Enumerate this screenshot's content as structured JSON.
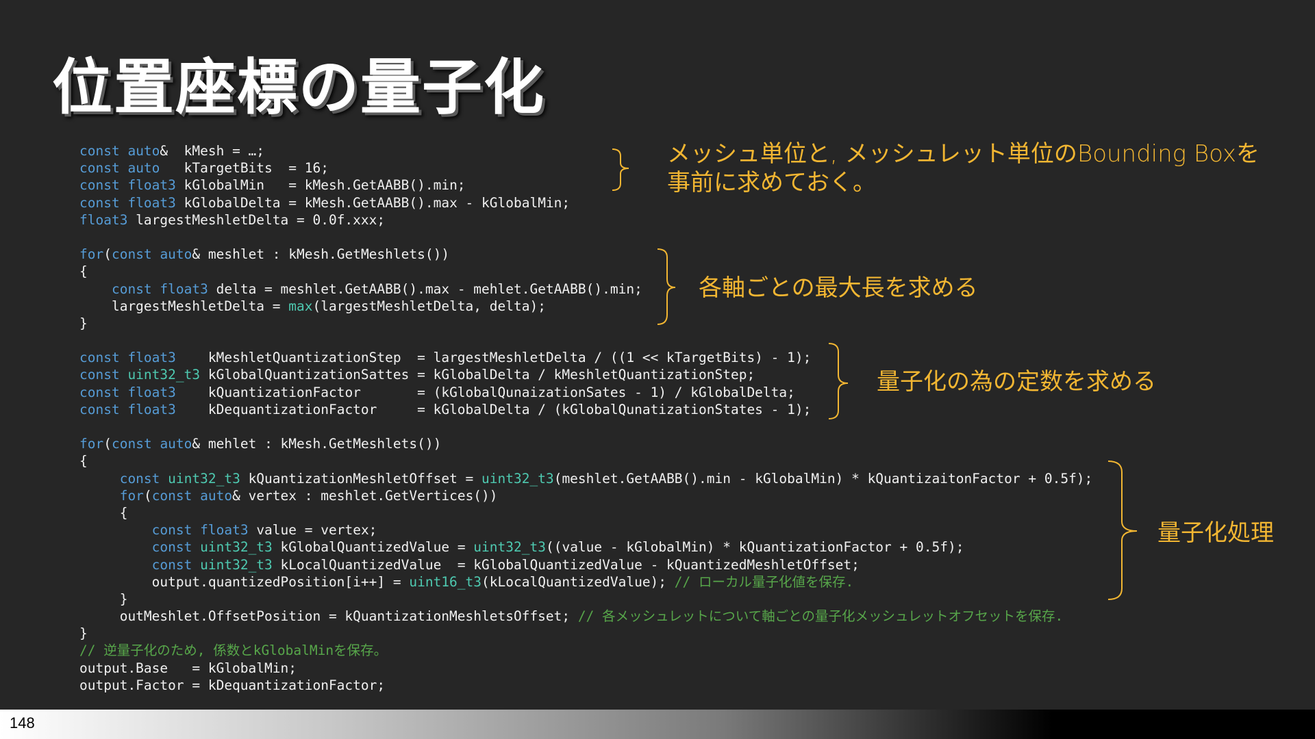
{
  "slide": {
    "title": "位置座標の量子化",
    "page_number": "148"
  },
  "code_lines": [
    [
      {
        "t": "const ",
        "c": "kw"
      },
      {
        "t": "auto",
        "c": "kw"
      },
      {
        "t": "&  kMesh = …;"
      }
    ],
    [
      {
        "t": "const ",
        "c": "kw"
      },
      {
        "t": "auto",
        "c": "kw"
      },
      {
        "t": "   kTargetBits  = 16;"
      }
    ],
    [
      {
        "t": "const ",
        "c": "kw"
      },
      {
        "t": "float3",
        "c": "kw"
      },
      {
        "t": " kGlobalMin   = kMesh.GetAABB().min;"
      }
    ],
    [
      {
        "t": "const ",
        "c": "kw"
      },
      {
        "t": "float3",
        "c": "kw"
      },
      {
        "t": " kGlobalDelta = kMesh.GetAABB().max - kGlobalMin;"
      }
    ],
    [
      {
        "t": "float3",
        "c": "kw"
      },
      {
        "t": " largestMeshletDelta = 0.0f.xxx;"
      }
    ],
    [],
    [
      {
        "t": "for",
        "c": "kw"
      },
      {
        "t": "("
      },
      {
        "t": "const ",
        "c": "kw"
      },
      {
        "t": "auto",
        "c": "kw"
      },
      {
        "t": "& meshlet : kMesh.GetMeshlets())"
      }
    ],
    [
      {
        "t": "{"
      }
    ],
    [
      {
        "t": "    "
      },
      {
        "t": "const ",
        "c": "kw"
      },
      {
        "t": "float3",
        "c": "kw"
      },
      {
        "t": " delta = meshlet.GetAABB().max - mehlet.GetAABB().min;"
      }
    ],
    [
      {
        "t": "    largestMeshletDelta = "
      },
      {
        "t": "max",
        "c": "ty"
      },
      {
        "t": "(largestMeshletDelta, delta);"
      }
    ],
    [
      {
        "t": "}"
      }
    ],
    [],
    [
      {
        "t": "const ",
        "c": "kw"
      },
      {
        "t": "float3",
        "c": "kw"
      },
      {
        "t": "    kMeshletQuantizationStep  = largestMeshletDelta / ((1 << kTargetBits) - 1);"
      }
    ],
    [
      {
        "t": "const ",
        "c": "kw"
      },
      {
        "t": "uint32_t3",
        "c": "ty"
      },
      {
        "t": " kGlobalQuantizationSattes = kGlobalDelta / kMeshletQuantizationStep;"
      }
    ],
    [
      {
        "t": "const ",
        "c": "kw"
      },
      {
        "t": "float3",
        "c": "kw"
      },
      {
        "t": "    kQuantizationFactor       = (kGlobalQunaizationSates - 1) / kGlobalDelta;"
      }
    ],
    [
      {
        "t": "const ",
        "c": "kw"
      },
      {
        "t": "float3",
        "c": "kw"
      },
      {
        "t": "    kDequantizationFactor     = kGlobalDelta / (kGlobalQunatizationStates - 1);"
      }
    ],
    [],
    [
      {
        "t": "for",
        "c": "kw"
      },
      {
        "t": "("
      },
      {
        "t": "const ",
        "c": "kw"
      },
      {
        "t": "auto",
        "c": "kw"
      },
      {
        "t": "& mehlet : kMesh.GetMeshlets())"
      }
    ],
    [
      {
        "t": "{"
      }
    ],
    [
      {
        "t": "     "
      },
      {
        "t": "const ",
        "c": "kw"
      },
      {
        "t": "uint32_t3",
        "c": "ty"
      },
      {
        "t": " kQuantizationMeshletOffset = "
      },
      {
        "t": "uint32_t3",
        "c": "ty"
      },
      {
        "t": "(meshlet.GetAABB().min - kGlobalMin) * kQuantizaitonFactor + 0.5f);"
      }
    ],
    [
      {
        "t": "     "
      },
      {
        "t": "for",
        "c": "kw"
      },
      {
        "t": "("
      },
      {
        "t": "const ",
        "c": "kw"
      },
      {
        "t": "auto",
        "c": "kw"
      },
      {
        "t": "& vertex : meshlet.GetVertices())"
      }
    ],
    [
      {
        "t": "     {"
      }
    ],
    [
      {
        "t": "         "
      },
      {
        "t": "const ",
        "c": "kw"
      },
      {
        "t": "float3",
        "c": "kw"
      },
      {
        "t": " value = vertex;"
      }
    ],
    [
      {
        "t": "         "
      },
      {
        "t": "const ",
        "c": "kw"
      },
      {
        "t": "uint32_t3",
        "c": "ty"
      },
      {
        "t": " kGlobalQuantizedValue = "
      },
      {
        "t": "uint32_t3",
        "c": "ty"
      },
      {
        "t": "((value - kGlobalMin) * kQuantizationFactor + 0.5f);"
      }
    ],
    [
      {
        "t": "         "
      },
      {
        "t": "const ",
        "c": "kw"
      },
      {
        "t": "uint32_t3",
        "c": "ty"
      },
      {
        "t": " kLocalQuantizedValue  = kGlobalQuantizedValue - kQuantizedMeshletOffset;"
      }
    ],
    [
      {
        "t": "         output.quantizedPosition[i++] = "
      },
      {
        "t": "uint16_t3",
        "c": "ty"
      },
      {
        "t": "(kLocalQuantizedValue); "
      },
      {
        "t": "// ローカル量子化値を保存.",
        "c": "cm"
      }
    ],
    [
      {
        "t": "     }"
      }
    ],
    [
      {
        "t": "     outMeshlet.OffsetPosition = kQuantizationMeshletsOffset; "
      },
      {
        "t": "// 各メッシュレットについて軸ごとの量子化メッシュレットオフセットを保存.",
        "c": "cm"
      }
    ],
    [
      {
        "t": "}"
      }
    ],
    [
      {
        "t": "// 逆量子化のため, 係数とkGlobalMinを保存。",
        "c": "cm"
      }
    ],
    [
      {
        "t": "output.Base   = kGlobalMin;"
      }
    ],
    [
      {
        "t": "output.Factor = kDequantizationFactor;"
      }
    ]
  ],
  "annotations": {
    "note1": "メッシュ単位と, メッシュレット単位のBounding Boxを\n事前に求めておく。",
    "note2": "各軸ごとの最大長を求める",
    "note3": "量子化の為の定数を求める",
    "note4": "量子化処理"
  },
  "colors": {
    "background": "#262626",
    "keyword": "#569cd6",
    "type": "#4ec9b0",
    "comment": "#57a64a",
    "annotation": "#f2b632"
  }
}
